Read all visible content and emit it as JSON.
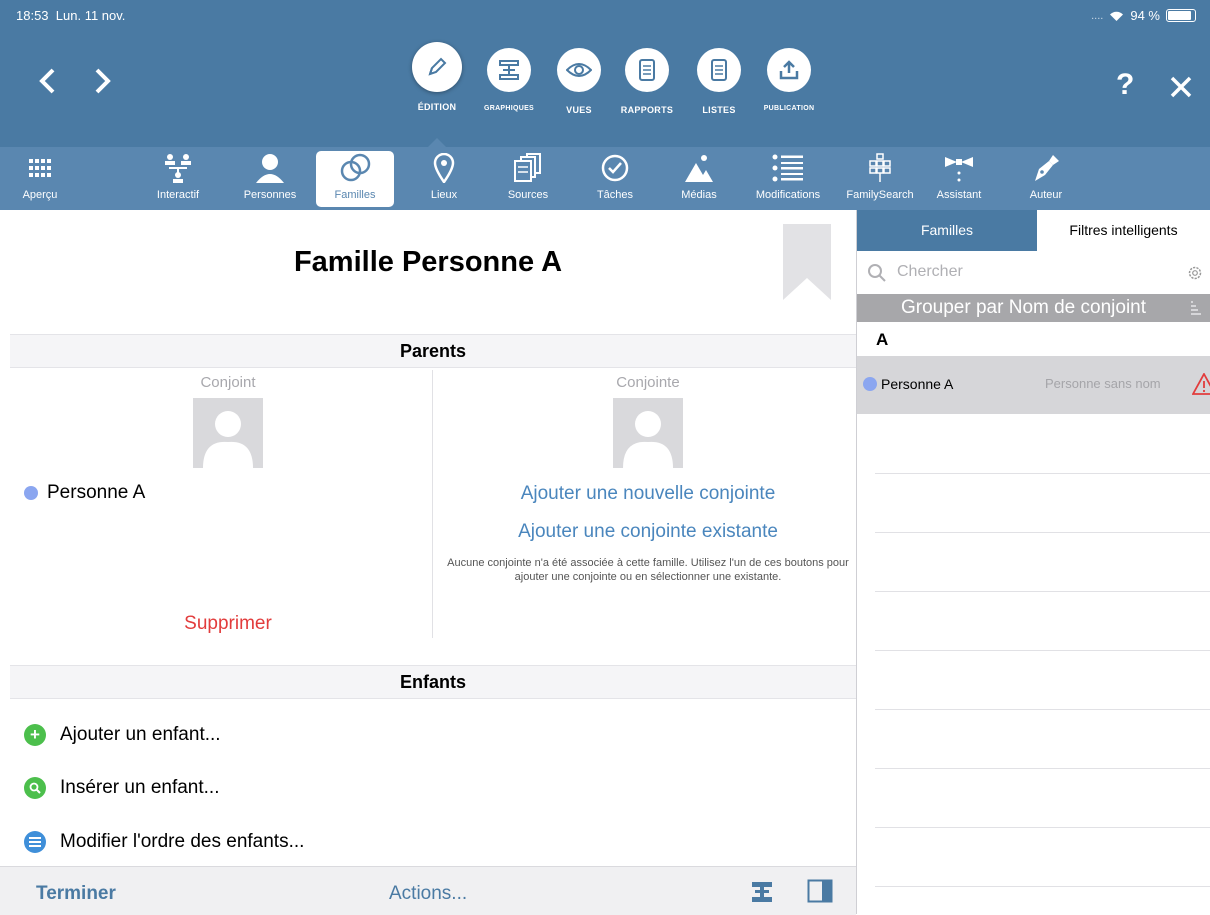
{
  "status": {
    "time": "18:53",
    "date": "Lun. 11 nov.",
    "signal": "....",
    "battery": "94 %"
  },
  "top": {
    "help": "?",
    "modes": [
      {
        "label": "ÉDITION"
      },
      {
        "label": "GRAPHIQUES"
      },
      {
        "label": "VUES"
      },
      {
        "label": "RAPPORTS"
      },
      {
        "label": "LISTES"
      },
      {
        "label": "PUBLICATION"
      }
    ]
  },
  "toolbar": {
    "items": [
      {
        "label": "Aperçu"
      },
      {
        "label": "Interactif"
      },
      {
        "label": "Personnes"
      },
      {
        "label": "Familles"
      },
      {
        "label": "Lieux"
      },
      {
        "label": "Sources"
      },
      {
        "label": "Tâches"
      },
      {
        "label": "Médias"
      },
      {
        "label": "Modifications"
      },
      {
        "label": "FamilySearch"
      },
      {
        "label": "Assistant"
      },
      {
        "label": "Auteur"
      }
    ]
  },
  "main": {
    "title": "Famille Personne A",
    "parents_header": "Parents",
    "husband_label": "Conjoint",
    "wife_label": "Conjointe",
    "husband_name": "Personne A",
    "add_new_wife": "Ajouter une nouvelle conjointe",
    "add_existing_wife": "Ajouter une conjointe existante",
    "no_wife_note": "Aucune conjointe n'a été associée à cette famille. Utilisez l'un de ces boutons pour ajouter une conjointe ou en sélectionner une existante.",
    "delete": "Supprimer",
    "children_header": "Enfants",
    "add_child": "Ajouter un enfant...",
    "insert_child": "Insérer un enfant...",
    "reorder_children": "Modifier l'ordre des enfants..."
  },
  "bottom": {
    "done": "Terminer",
    "actions": "Actions..."
  },
  "sidebar": {
    "tab_families": "Familles",
    "tab_smart_filters": "Filtres intelligents",
    "search_placeholder": "Chercher",
    "group_by": "Grouper par Nom de conjoint",
    "section_letter": "A",
    "rows": [
      {
        "name": "Personne A",
        "partner": "Personne sans nom"
      }
    ]
  },
  "colors": {
    "header": "#4a7aa3",
    "toolbar": "#5a87b0",
    "link": "#4a86bd",
    "delete": "#e23c3c",
    "male_dot": "#8ba6f0",
    "warning": "#e23c3c"
  }
}
